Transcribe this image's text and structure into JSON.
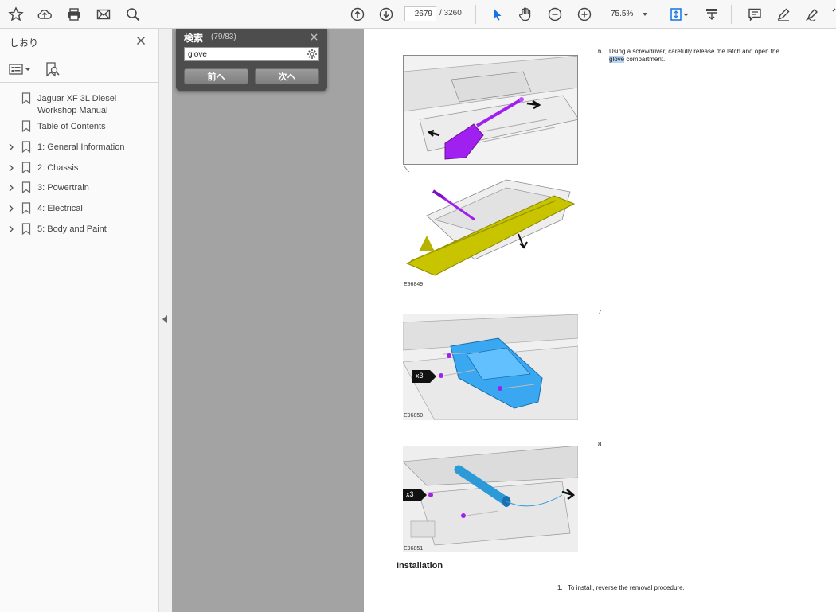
{
  "toolbar": {
    "page_current": "2679",
    "page_total": "/ 3260",
    "zoom": "75.5%"
  },
  "bookmarks": {
    "title": "しおり",
    "items": [
      {
        "label": "Jaguar XF 3L Diesel Workshop Manual",
        "has_children": false
      },
      {
        "label": "Table of Contents",
        "has_children": false
      },
      {
        "label": "1: General Information",
        "has_children": true
      },
      {
        "label": "2: Chassis",
        "has_children": true
      },
      {
        "label": "3: Powertrain",
        "has_children": true
      },
      {
        "label": "4: Electrical",
        "has_children": true
      },
      {
        "label": "5: Body and Paint",
        "has_children": true
      }
    ]
  },
  "find": {
    "title": "検索",
    "count": "(79/83)",
    "query": "glove",
    "prev_label": "前へ",
    "next_label": "次へ"
  },
  "document": {
    "steps": [
      {
        "number": "6.",
        "text_before": "Using a screwdriver, carefully release the latch and open the ",
        "highlight": "glove",
        "text_after": " compartment."
      },
      {
        "number": "7."
      },
      {
        "number": "8."
      }
    ],
    "figures": [
      {
        "code": "E96849"
      },
      {
        "code": "E96850",
        "callout": "x3"
      },
      {
        "code": "E96851",
        "callout": "x3"
      }
    ],
    "section_heading": "Installation",
    "install_steps": [
      {
        "number": "1.",
        "text": "To install, reverse the removal procedure."
      }
    ]
  },
  "colors": {
    "accent": "#1473e6",
    "highlight": "#b8d4f0",
    "part_purple": "#a020f0",
    "part_yellow": "#c8c400",
    "part_blue": "#3aa8f0"
  }
}
